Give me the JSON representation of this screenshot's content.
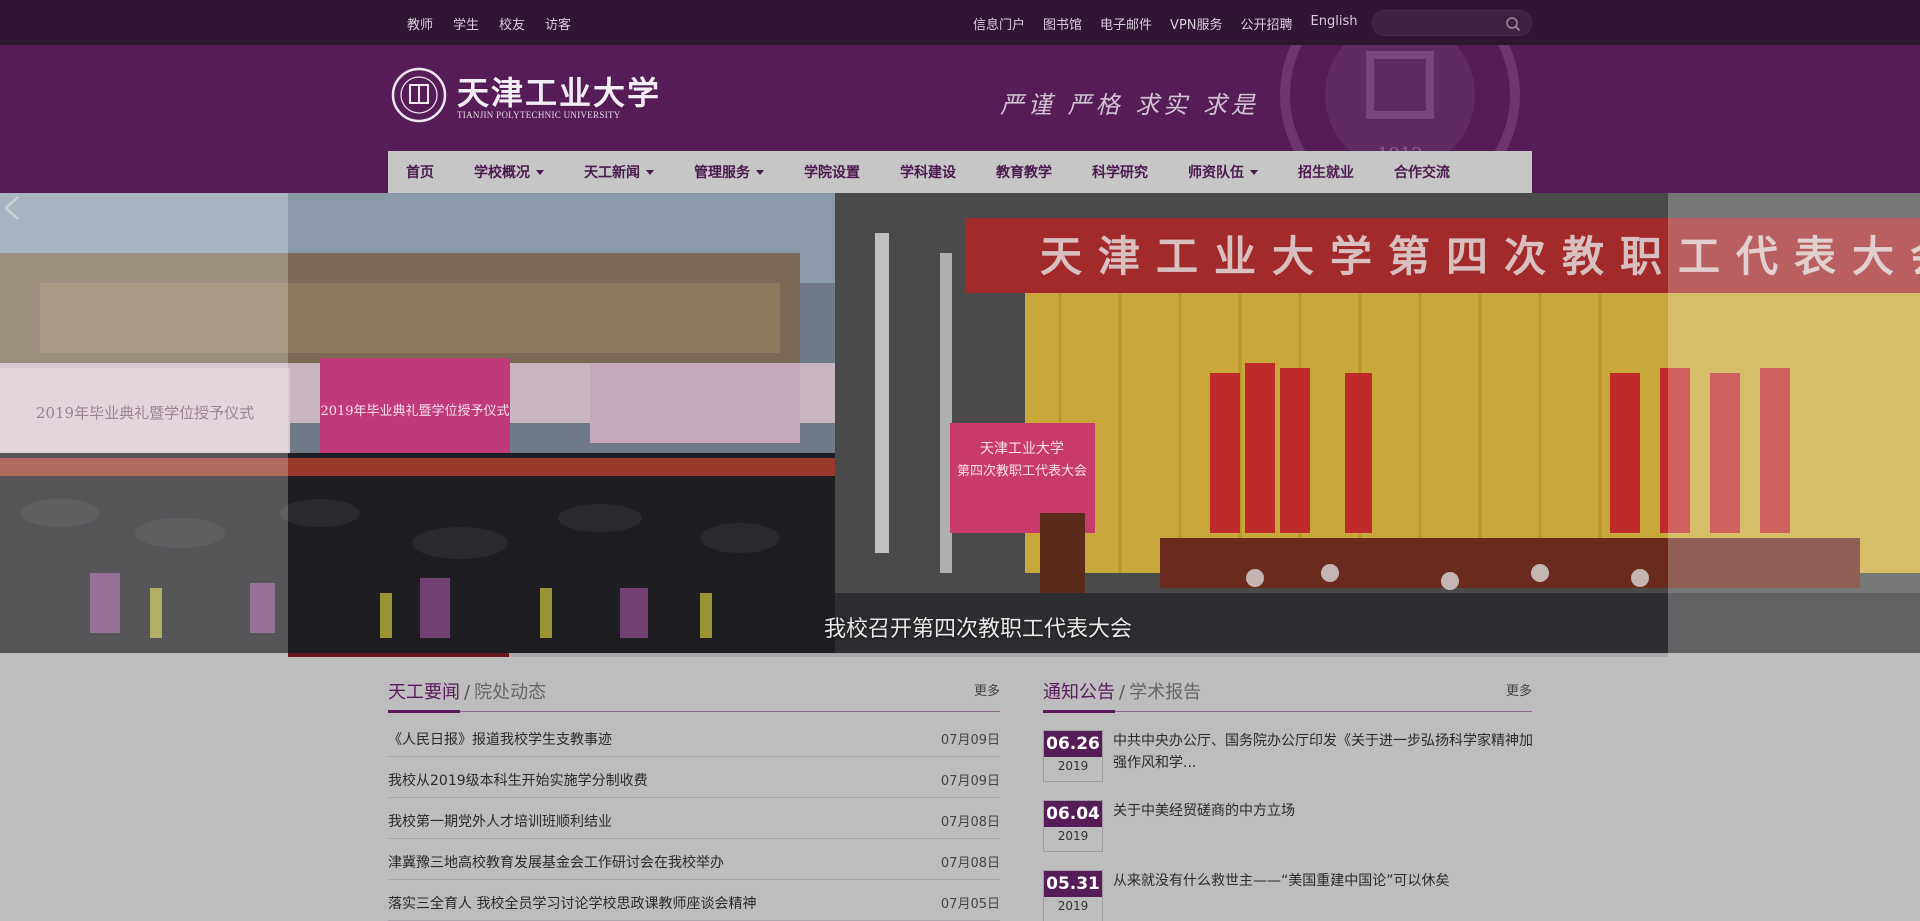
{
  "topbar": {
    "left_links": [
      "教师",
      "学生",
      "校友",
      "访客"
    ],
    "right_links": [
      "信息门户",
      "图书馆",
      "电子邮件",
      "VPN服务",
      "公开招聘",
      "English"
    ],
    "search_placeholder": ""
  },
  "header": {
    "logo_cn": "天津工业大学",
    "logo_en": "TIANJIN POLYTECHNIC UNIVERSITY",
    "motto": "严谨 严格 求实 求是",
    "seal_year": "~1912~"
  },
  "nav": [
    {
      "label": "首页",
      "dropdown": false
    },
    {
      "label": "学校概况",
      "dropdown": true
    },
    {
      "label": "天工新闻",
      "dropdown": true
    },
    {
      "label": "管理服务",
      "dropdown": true
    },
    {
      "label": "学院设置",
      "dropdown": false
    },
    {
      "label": "学科建设",
      "dropdown": false
    },
    {
      "label": "教育教学",
      "dropdown": false
    },
    {
      "label": "科学研究",
      "dropdown": false
    },
    {
      "label": "师资队伍",
      "dropdown": true
    },
    {
      "label": "招生就业",
      "dropdown": false
    },
    {
      "label": "合作交流",
      "dropdown": false
    }
  ],
  "banner": {
    "caption": "我校召开第四次教职工代表大会",
    "slide_banner_text": "天津工业大学第四次教职工代表大会",
    "sign_line1": "天津工业大学",
    "sign_line2": "第四次教职工代表大会",
    "graduation_text": "2019年毕业典礼暨学位授予仪式",
    "progress": 0.16
  },
  "news": {
    "tab_active": "天工要闻",
    "tab_inactive": "院处动态",
    "more": "更多",
    "items": [
      {
        "title": "《人民日报》报道我校学生支教事迹",
        "date": "07月09日"
      },
      {
        "title": "我校从2019级本科生开始实施学分制收费",
        "date": "07月09日"
      },
      {
        "title": "我校第一期党外人才培训班顺利结业",
        "date": "07月08日"
      },
      {
        "title": "津冀豫三地高校教育发展基金会工作研讨会在我校举办",
        "date": "07月08日"
      },
      {
        "title": "落实三全育人 我校全员学习讨论学校思政课教师座谈会精神",
        "date": "07月05日"
      }
    ]
  },
  "notices": {
    "tab_active": "通知公告",
    "tab_inactive": "学术报告",
    "more": "更多",
    "items": [
      {
        "md": "06.26",
        "year": "2019",
        "text": "中共中央办公厅、国务院办公厅印发《关于进一步弘扬科学家精神加强作风和学..."
      },
      {
        "md": "06.04",
        "year": "2019",
        "text": "关于中美经贸磋商的中方立场"
      },
      {
        "md": "05.31",
        "year": "2019",
        "text": "从来就没有什么救世主——“美国重建中国论”可以休矣"
      }
    ]
  },
  "colors": {
    "brand_purple": "#561c58",
    "topbar": "#2f1632",
    "accent_red": "#6b1520"
  }
}
